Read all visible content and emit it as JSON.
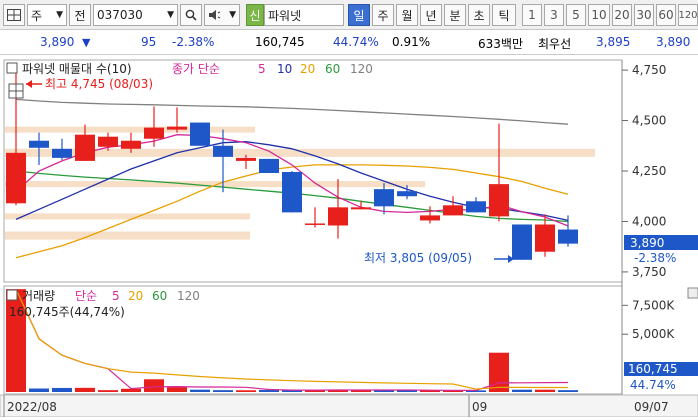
{
  "toolbar": {
    "market_label": "주",
    "prev_label": "전",
    "stock_code": "037030",
    "shin_label": "신",
    "stock_name": "파워넷",
    "periods": [
      "일",
      "주",
      "월",
      "년",
      "분",
      "초",
      "틱"
    ],
    "selected_period": "일",
    "numbers": [
      "1",
      "3",
      "5",
      "10",
      "20",
      "30",
      "60",
      "120"
    ]
  },
  "info": {
    "price": "3,890",
    "change": "95",
    "change_pct": "-2.38%",
    "volume": "160,745",
    "volume_ratio": "44.74%",
    "turnover": "0.91%",
    "amount": "633백만",
    "best_ask_label": "최우선",
    "best_ask": "3,895",
    "best_bid": "3,890"
  },
  "price_panel": {
    "legend_main": "파워넷 매물대 수(10)",
    "legend_ma": "종가 단순",
    "ma_periods": [
      "5",
      "10",
      "20",
      "60",
      "120"
    ],
    "high_label": "최고 4,745 (08/03)",
    "low_label": "최저 3,805 (09/05)",
    "current_price_label": "3,890",
    "current_change_label": "-2.38%"
  },
  "volume_panel": {
    "legend_main": "거래량",
    "legend_ma": "단순",
    "ma_periods": [
      "5",
      "20",
      "60",
      "120"
    ],
    "volume_note": "160,745주(44,74%)",
    "current_volume_label": "160,745",
    "current_ratio_label": "44.74%"
  },
  "date_axis": {
    "labels": [
      "2022/08",
      "09"
    ],
    "right_label": "09/07"
  },
  "colors": {
    "up": "#e8201c",
    "down": "#1e57c8",
    "ma5": "#d4289a",
    "ma10": "#2030a8",
    "ma20": "#e8a000",
    "ma60": "#2a9a3a",
    "ma120": "#808080",
    "volume_profile": "#f6dfc6"
  },
  "chart_data": [
    {
      "type": "candlestick",
      "title": "파워넷 매물대 수(10)",
      "ylim": [
        3700,
        4800
      ],
      "yticks": [
        3750,
        4000,
        4250,
        4500,
        4750
      ],
      "ytick_labels": [
        "3,750",
        "4,000",
        "4,250",
        "4,500",
        "4,750"
      ],
      "candles": [
        {
          "o": 4090,
          "h": 4745,
          "l": 4080,
          "c": 4340
        },
        {
          "o": 4400,
          "h": 4440,
          "l": 4280,
          "c": 4365
        },
        {
          "o": 4360,
          "h": 4410,
          "l": 4305,
          "c": 4315
        },
        {
          "o": 4300,
          "h": 4480,
          "l": 4300,
          "c": 4430
        },
        {
          "o": 4370,
          "h": 4440,
          "l": 4350,
          "c": 4420
        },
        {
          "o": 4360,
          "h": 4440,
          "l": 4340,
          "c": 4400
        },
        {
          "o": 4410,
          "h": 4570,
          "l": 4370,
          "c": 4465
        },
        {
          "o": 4455,
          "h": 4565,
          "l": 4440,
          "c": 4470
        },
        {
          "o": 4490,
          "h": 4490,
          "l": 4375,
          "c": 4375
        },
        {
          "o": 4375,
          "h": 4455,
          "l": 4145,
          "c": 4320
        },
        {
          "o": 4300,
          "h": 4330,
          "l": 4260,
          "c": 4315
        },
        {
          "o": 4310,
          "h": 4310,
          "l": 4240,
          "c": 4240
        },
        {
          "o": 4245,
          "h": 4250,
          "l": 4045,
          "c": 4045
        },
        {
          "o": 3990,
          "h": 4070,
          "l": 3970,
          "c": 3990
        },
        {
          "o": 3980,
          "h": 4210,
          "l": 3915,
          "c": 4070
        },
        {
          "o": 4060,
          "h": 4100,
          "l": 4060,
          "c": 4070
        },
        {
          "o": 4160,
          "h": 4190,
          "l": 4035,
          "c": 4075
        },
        {
          "o": 4150,
          "h": 4180,
          "l": 4110,
          "c": 4125
        },
        {
          "o": 4005,
          "h": 4075,
          "l": 3990,
          "c": 4030
        },
        {
          "o": 4030,
          "h": 4125,
          "l": 4030,
          "c": 4080
        },
        {
          "o": 4100,
          "h": 4120,
          "l": 4045,
          "c": 4045
        },
        {
          "o": 4025,
          "h": 4485,
          "l": 4000,
          "c": 4185
        },
        {
          "o": 3985,
          "h": 3985,
          "l": 3810,
          "c": 3810
        },
        {
          "o": 3850,
          "h": 4035,
          "l": 3825,
          "c": 3985
        },
        {
          "o": 3960,
          "h": 4030,
          "l": 3875,
          "c": 3890
        }
      ],
      "moving_averages": {
        "ma5": [
          4150,
          4250,
          4300,
          4340,
          4368,
          4380,
          4398,
          4430,
          4426,
          4410,
          4390,
          4348,
          4280,
          4190,
          4120,
          4070,
          4050,
          4045,
          4050,
          4060,
          4055,
          4082,
          4048,
          4022,
          3978
        ],
        "ma10": [
          4010,
          4060,
          4110,
          4160,
          4210,
          4260,
          4300,
          4340,
          4365,
          4390,
          4395,
          4380,
          4360,
          4325,
          4285,
          4240,
          4200,
          4160,
          4125,
          4095,
          4070,
          4065,
          4048,
          4030,
          4005
        ],
        "ma20": [
          3820,
          3850,
          3880,
          3920,
          3965,
          4010,
          4055,
          4100,
          4150,
          4195,
          4225,
          4255,
          4270,
          4280,
          4280,
          4280,
          4278,
          4275,
          4268,
          4258,
          4240,
          4222,
          4198,
          4165,
          4135
        ],
        "ma60": [
          4250,
          4238,
          4228,
          4220,
          4213,
          4206,
          4198,
          4190,
          4180,
          4170,
          4160,
          4150,
          4140,
          4128,
          4115,
          4100,
          4085,
          4070,
          4055,
          4040,
          4025,
          4015,
          4010,
          4007,
          4000
        ],
        "ma120": [
          4605,
          4597,
          4590,
          4586,
          4582,
          4580,
          4578,
          4575,
          4572,
          4570,
          4568,
          4564,
          4560,
          4555,
          4550,
          4544,
          4538,
          4532,
          4526,
          4520,
          4513,
          4506,
          4498,
          4490,
          4482
        ]
      }
    },
    {
      "type": "bar",
      "title": "거래량",
      "ylim": [
        0,
        9000
      ],
      "yticks": [
        5000,
        7500
      ],
      "ytick_labels": [
        "5,000K",
        "7,500K"
      ],
      "values": [
        8900,
        300,
        350,
        360,
        160,
        280,
        1100,
        420,
        200,
        160,
        150,
        170,
        160,
        180,
        220,
        140,
        150,
        160,
        130,
        120,
        140,
        3400,
        200,
        200,
        160
      ]
    }
  ]
}
